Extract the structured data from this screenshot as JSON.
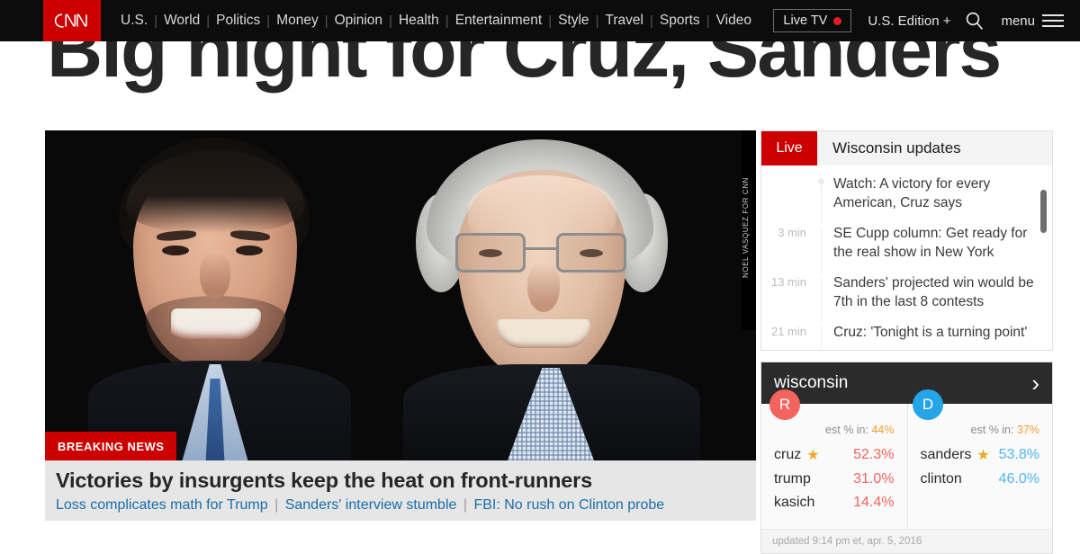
{
  "header": {
    "logo_alt": "CNN",
    "nav_items": [
      "U.S.",
      "World",
      "Politics",
      "Money",
      "Opinion",
      "Health",
      "Entertainment",
      "Style",
      "Travel",
      "Sports",
      "Video"
    ],
    "live_tv_label": "Live TV",
    "edition_label": "U.S. Edition +",
    "menu_label": "menu"
  },
  "mega_headline": "Big night for Cruz, Sanders",
  "lead": {
    "photo_credit": "NOEL VASQUEZ FOR CNN",
    "breaking_label": "BREAKING NEWS",
    "title": "Victories by insurgents keep the heat on front-runners",
    "links": [
      "Loss complicates math for Trump",
      "Sanders' interview stumble",
      "FBI: No rush on Clinton probe"
    ]
  },
  "updates": {
    "live_label": "Live",
    "title": "Wisconsin updates",
    "items": [
      {
        "time": "",
        "text": "Watch: A victory for every American, Cruz says"
      },
      {
        "time": "3 min",
        "text": "SE Cupp column: Get ready for the real show in New York"
      },
      {
        "time": "13 min",
        "text": "Sanders' projected win would be 7th in the last 8 contests"
      },
      {
        "time": "21 min",
        "text": "Cruz: 'Tonight is a turning point'"
      }
    ]
  },
  "results": {
    "state": "wisconsin",
    "chevron": "›",
    "republican": {
      "badge": "R",
      "pct_in_label": "est % in:",
      "pct_in_value": "44%",
      "candidates": [
        {
          "name": "cruz",
          "pct": "52.3%",
          "winner": true
        },
        {
          "name": "trump",
          "pct": "31.0%",
          "winner": false
        },
        {
          "name": "kasich",
          "pct": "14.4%",
          "winner": false
        }
      ]
    },
    "democrat": {
      "badge": "D",
      "pct_in_label": "est % in:",
      "pct_in_value": "37%",
      "candidates": [
        {
          "name": "sanders",
          "pct": "53.8%",
          "winner": true
        },
        {
          "name": "clinton",
          "pct": "46.0%",
          "winner": false
        }
      ]
    },
    "updated": "updated 9:14 pm et, apr. 5, 2016"
  },
  "colors": {
    "cnn_red": "#cc0000",
    "republican": "#f4645f",
    "democrat": "#26a4e8",
    "link_blue": "#1a6ca8",
    "star_gold": "#f0a82a",
    "pct_in_orange": "#f0a030"
  }
}
